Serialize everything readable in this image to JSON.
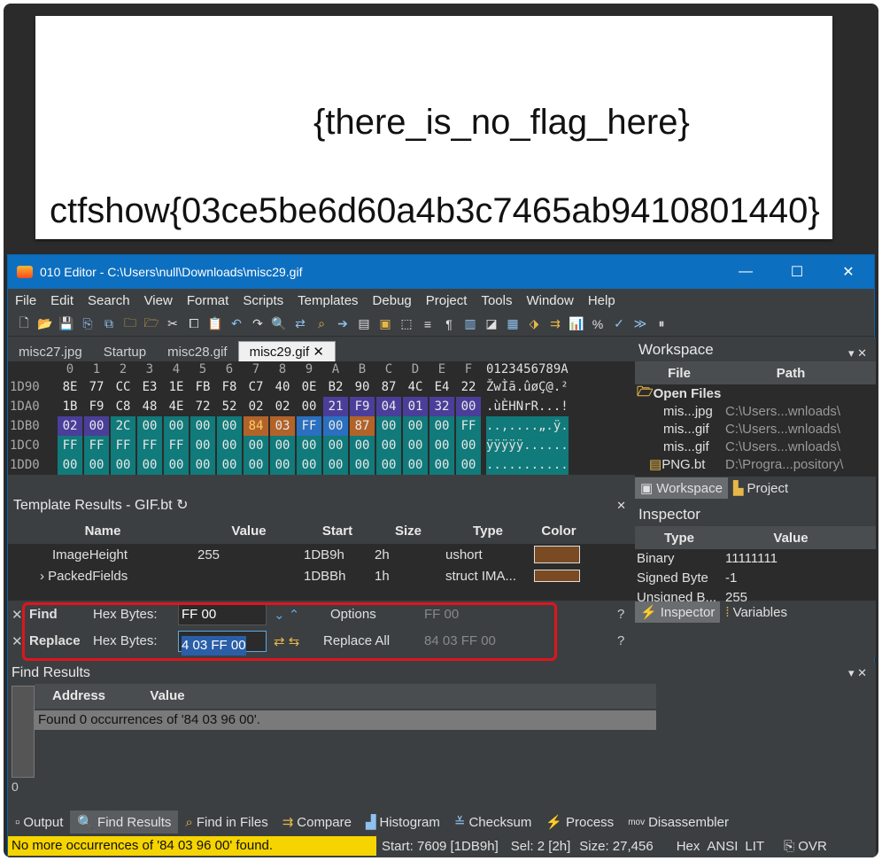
{
  "preview": {
    "line1": "{there_is_no_flag_here}",
    "line2": "ctfshow{03ce5be6d60a4b3c7465ab9410801440}"
  },
  "window": {
    "title": "010 Editor - C:\\Users\\null\\Downloads\\misc29.gif",
    "minimize": "—",
    "maximize": "☐",
    "close": "✕"
  },
  "menu": [
    "File",
    "Edit",
    "Search",
    "View",
    "Format",
    "Scripts",
    "Templates",
    "Debug",
    "Project",
    "Tools",
    "Window",
    "Help"
  ],
  "tabs": [
    "misc27.jpg",
    "Startup",
    "misc28.gif",
    "misc29.gif"
  ],
  "hex": {
    "columns": [
      "0",
      "1",
      "2",
      "3",
      "4",
      "5",
      "6",
      "7",
      "8",
      "9",
      "A",
      "B",
      "C",
      "D",
      "E",
      "F"
    ],
    "ascii_header": "0123456789A",
    "rows": [
      {
        "addr": "1D90",
        "bytes": [
          "8E",
          "77",
          "CC",
          "E3",
          "1E",
          "FB",
          "F8",
          "C7",
          "40",
          "0E",
          "B2",
          "90",
          "87",
          "4C",
          "E4",
          "22"
        ],
        "ascii": "ŽwÌã.ûøÇ@.²"
      },
      {
        "addr": "1DA0",
        "bytes": [
          "1B",
          "F9",
          "C8",
          "48",
          "4E",
          "72",
          "52",
          "02",
          "02",
          "00",
          "21",
          "F9",
          "04",
          "01",
          "32",
          "00"
        ],
        "ascii": ".ùÈHNrR...!"
      },
      {
        "addr": "1DB0",
        "bytes": [
          "02",
          "00",
          "2C",
          "00",
          "00",
          "00",
          "00",
          "84",
          "03",
          "FF",
          "00",
          "87",
          "00",
          "00",
          "00",
          "FF"
        ],
        "ascii": "..,....„.ÿ."
      },
      {
        "addr": "1DC0",
        "bytes": [
          "FF",
          "FF",
          "FF",
          "FF",
          "FF",
          "00",
          "00",
          "00",
          "00",
          "00",
          "00",
          "00",
          "00",
          "00",
          "00",
          "00"
        ],
        "ascii": "ÿÿÿÿÿ......"
      },
      {
        "addr": "1DD0",
        "bytes": [
          "00",
          "00",
          "00",
          "00",
          "00",
          "00",
          "00",
          "00",
          "00",
          "00",
          "00",
          "00",
          "00",
          "00",
          "00",
          "00"
        ],
        "ascii": "..........."
      }
    ]
  },
  "template": {
    "title": "Template Results - GIF.bt",
    "headers": [
      "Name",
      "Value",
      "Start",
      "Size",
      "Type",
      "Color"
    ],
    "rows": [
      {
        "name": "ImageHeight",
        "value": "255",
        "start": "1DB9h",
        "size": "2h",
        "type": "ushort"
      },
      {
        "name": "PackedFields",
        "value": "",
        "start": "1DBBh",
        "size": "1h",
        "type": "struct IMA..."
      }
    ]
  },
  "find": {
    "find_label": "Find",
    "replace_label": "Replace",
    "hex_label": "Hex Bytes:",
    "find_value": "FF 00",
    "replace_value": "4 03 FF 00",
    "options_label": "Options",
    "replace_all_label": "Replace All",
    "find_preview": "FF 00",
    "replace_preview": "84 03 FF 00"
  },
  "find_results": {
    "title": "Find Results",
    "headers": [
      "Address",
      "Value"
    ],
    "message": "Found 0 occurrences of '84 03 96 00'.",
    "count": "0"
  },
  "bottom_tabs": [
    "Output",
    "Find Results",
    "Find in Files",
    "Compare",
    "Histogram",
    "Checksum",
    "Process",
    "Disassembler"
  ],
  "status": {
    "message": "No more occurrences of '84 03 96 00' found.",
    "start": "Start: 7609 [1DB9h]",
    "sel": "Sel: 2 [2h]",
    "size": "Size: 27,456",
    "hex": "Hex",
    "ansi": "ANSI",
    "lit": "LIT",
    "ovr": "OVR"
  },
  "workspace": {
    "title": "Workspace",
    "headers": [
      "File",
      "Path"
    ],
    "group": "Open Files",
    "files": [
      {
        "name": "mis...jpg",
        "path": "C:\\Users...wnloads\\"
      },
      {
        "name": "mis...gif",
        "path": "C:\\Users...wnloads\\"
      },
      {
        "name": "mis...gif",
        "path": "C:\\Users...wnloads\\"
      },
      {
        "name": "PNG.bt",
        "path": "D:\\Progra...pository\\"
      }
    ],
    "partial": "Project",
    "tabs": [
      "Workspace",
      "Project"
    ]
  },
  "inspector": {
    "title": "Inspector",
    "headers": [
      "Type",
      "Value"
    ],
    "rows": [
      {
        "type": "Binary",
        "value": "11111111"
      },
      {
        "type": "Signed Byte",
        "value": "-1"
      },
      {
        "type": "Unsigned B...",
        "value": "255"
      }
    ],
    "tabs": [
      "Inspector",
      "Variables"
    ]
  },
  "colors": {
    "titlebar": "#0d6fc0",
    "highlight_red": "#e0141e",
    "status_yellow": "#f5d400",
    "hex_purple": "#4b3e9a",
    "hex_teal": "#117a7a",
    "hex_orange": "#b2632a"
  }
}
